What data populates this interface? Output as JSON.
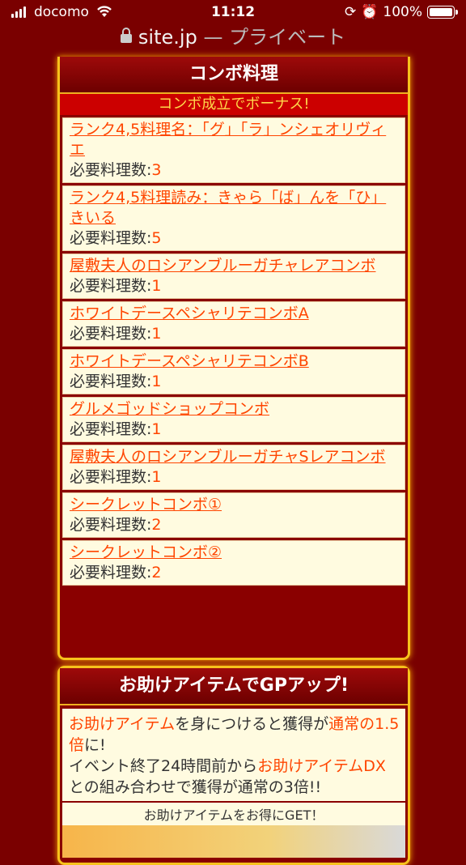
{
  "status": {
    "carrier": "docomo",
    "time": "11:12",
    "battery": "100%"
  },
  "url": {
    "host": "site.jp",
    "suffix": " — プライベート"
  },
  "combo": {
    "title": "コンボ料理",
    "bonus": "コンボ成立でボーナス!",
    "req_label": "必要料理数:",
    "items": [
      {
        "name": "ランク4,5料理名：「グ」「ラ」ンシェオリヴィエ",
        "count": "3"
      },
      {
        "name": "ランク4,5料理読み：きゃら「ば」んを「ひ」きいる",
        "count": "5"
      },
      {
        "name": "屋敷夫人のロシアンブルーガチャレアコンボ",
        "count": "1"
      },
      {
        "name": "ホワイトデースペシャリテコンボA",
        "count": "1"
      },
      {
        "name": "ホワイトデースペシャリテコンボB",
        "count": "1"
      },
      {
        "name": "グルメゴッドショップコンボ",
        "count": "1"
      },
      {
        "name": "屋敷夫人のロシアンブルーガチャSレアコンボ",
        "count": "1"
      },
      {
        "name": "シークレットコンボ①",
        "count": "2"
      },
      {
        "name": "シークレットコンボ②",
        "count": "2"
      }
    ]
  },
  "help": {
    "title": "お助けアイテムでGPアップ!",
    "p1_a": "お助けアイテム",
    "p1_b": "を身につけると獲得が",
    "p1_c": "通常の1.5倍",
    "p1_d": "に!",
    "p2_a": "イベント終了24時間前から",
    "p2_b": "お助けアイテムDX",
    "p2_c": "との組み合わせで獲得が通常の3倍!!",
    "sub": "お助けアイテムをお得にGET！"
  }
}
